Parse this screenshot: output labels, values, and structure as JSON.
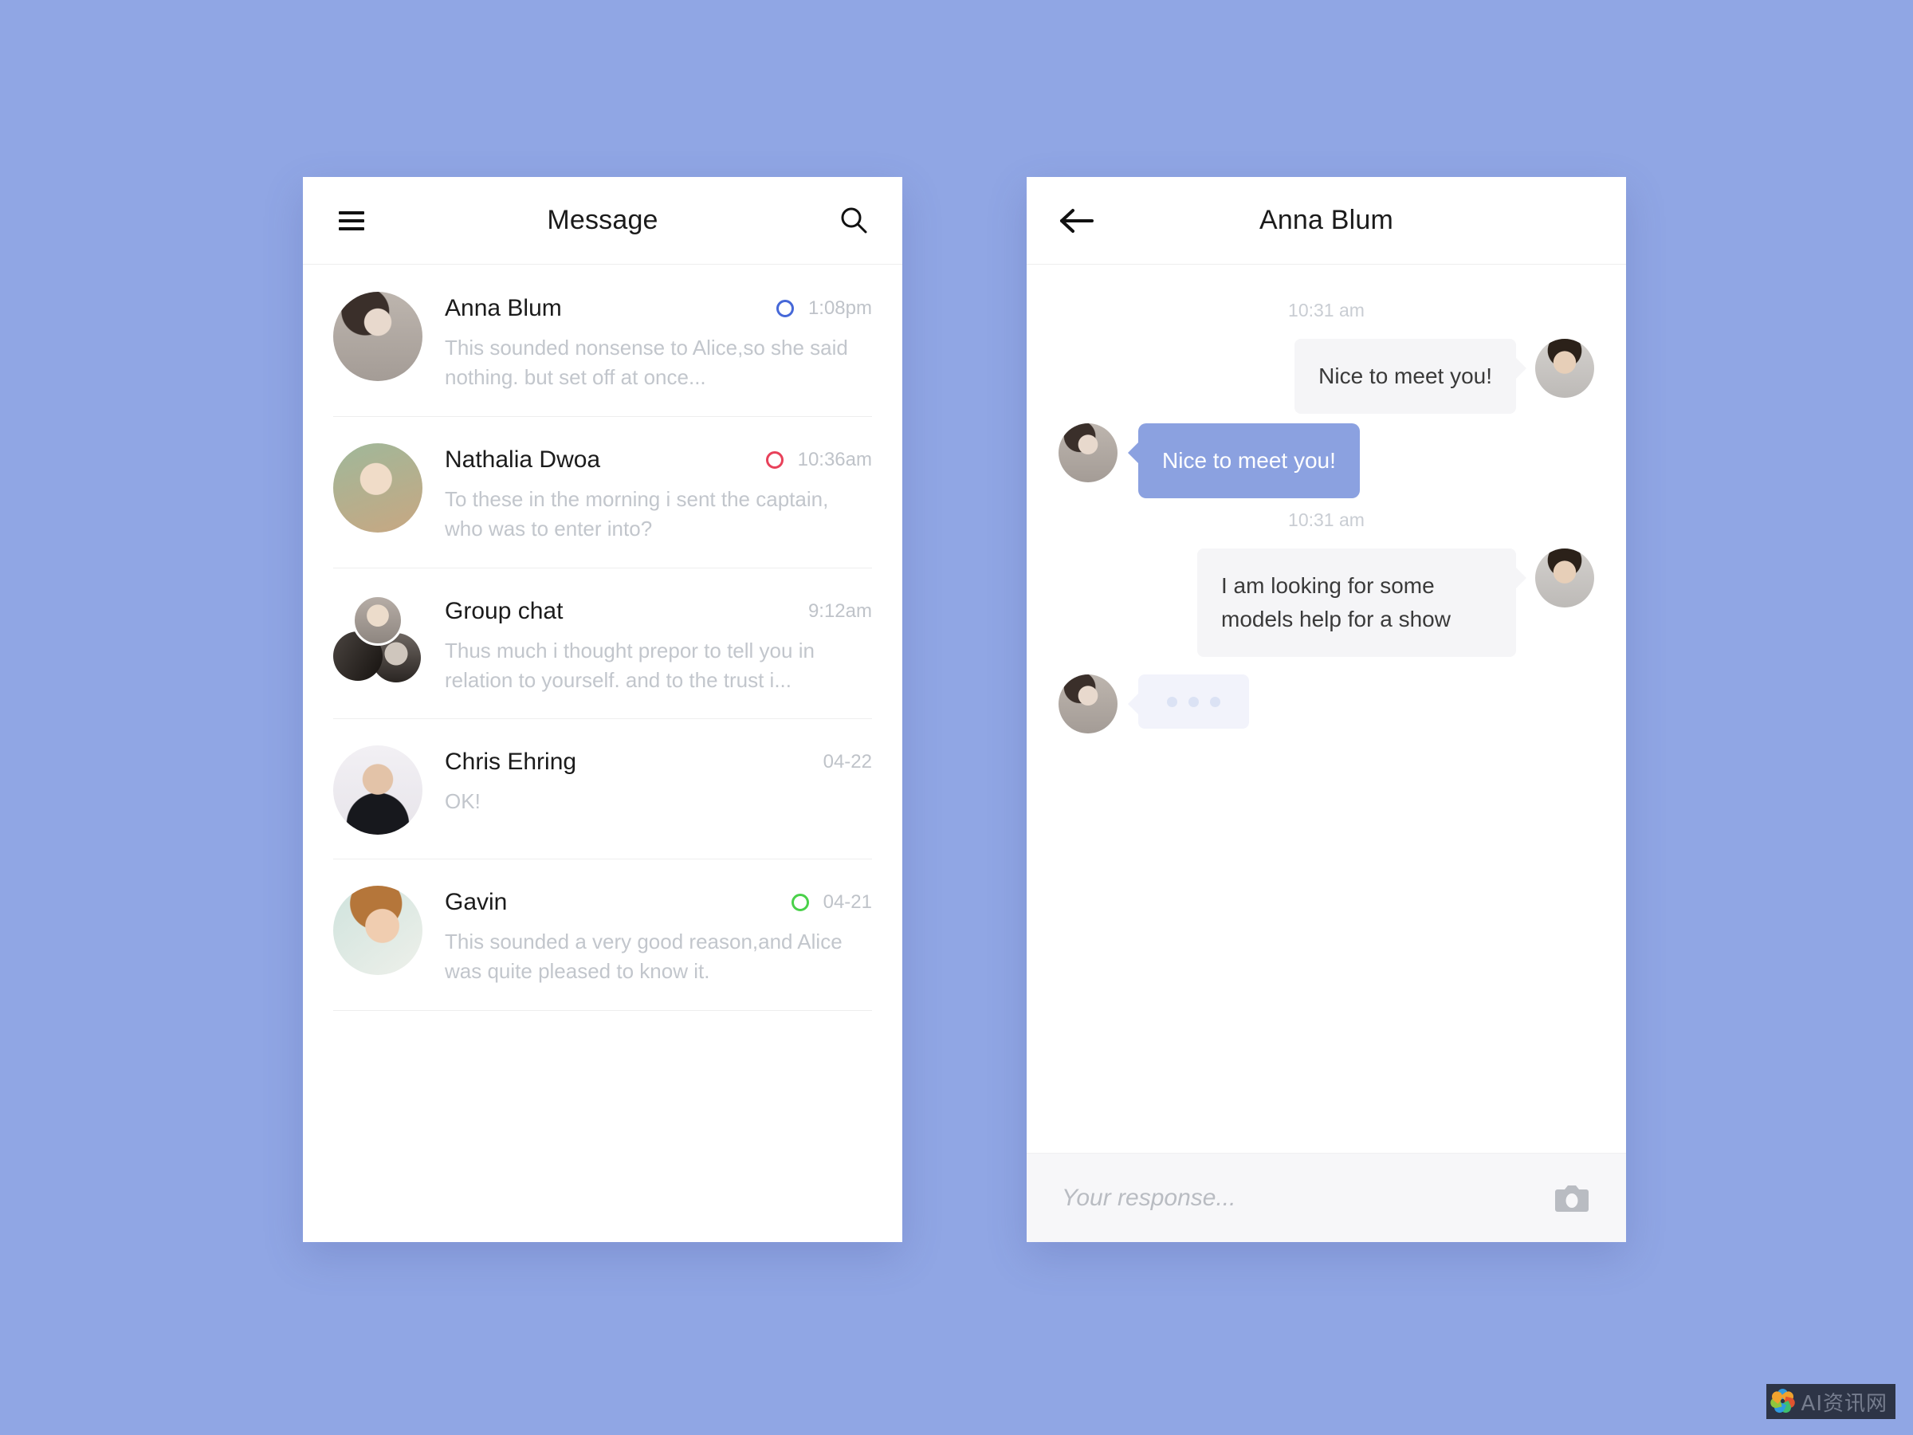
{
  "background_color": "#90a6e4",
  "list_screen": {
    "menu_icon": "hamburger-icon",
    "title": "Message",
    "search_icon": "search-icon",
    "conversations": [
      {
        "name": "Anna Blum",
        "time": "1:08pm",
        "status_color": "#4668d8",
        "snippet": "This sounded nonsense to Alice,so she said nothing. but set off at once...",
        "avatar_type": "single"
      },
      {
        "name": "Nathalia Dwoa",
        "time": "10:36am",
        "status_color": "#e8415a",
        "snippet": "To these in the morning i sent the captain, who was to enter into?",
        "avatar_type": "single"
      },
      {
        "name": "Group chat",
        "time": "9:12am",
        "status_color": "none",
        "snippet": "Thus much i thought prepor to tell you in relation to yourself. and to the trust i...",
        "avatar_type": "cluster"
      },
      {
        "name": "Chris Ehring",
        "time": "04-22",
        "status_color": "none",
        "snippet": "OK!",
        "avatar_type": "single"
      },
      {
        "name": "Gavin",
        "time": "04-21",
        "status_color": "#4ad14a",
        "snippet": "This sounded a very good reason,and Alice was quite pleased to know it.",
        "avatar_type": "single"
      }
    ]
  },
  "chat_screen": {
    "back_icon": "arrow-left-icon",
    "title": "Anna Blum",
    "messages": [
      {
        "kind": "timestamp",
        "text": "10:31 am"
      },
      {
        "kind": "out",
        "text": "Nice to meet you!",
        "avatar": "man-glasses-avatar"
      },
      {
        "kind": "in",
        "text": "Nice to meet you!",
        "avatar": "anna-avatar",
        "bubble_color": "#8ba1e0"
      },
      {
        "kind": "timestamp",
        "text": "10:31 am"
      },
      {
        "kind": "out",
        "text": "I am looking for some models help for a show",
        "avatar": "man-glasses-avatar"
      },
      {
        "kind": "typing",
        "text": "",
        "avatar": "anna-avatar"
      }
    ],
    "composer": {
      "placeholder": "Your response...",
      "value": "",
      "camera_icon": "camera-icon"
    }
  },
  "watermark": {
    "text": "AI资讯网"
  }
}
